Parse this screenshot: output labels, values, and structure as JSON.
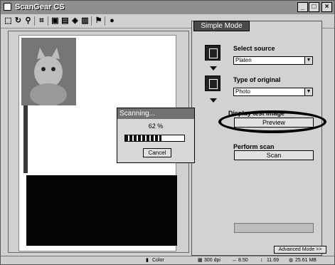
{
  "window": {
    "title": "ScanGear CS",
    "minimize_glyph": "_",
    "maximize_glyph": "□",
    "close_glyph": "×"
  },
  "toolbar": {
    "icons": [
      "select-all-icon",
      "rotate-icon",
      "zoom-icon",
      "fit-icon",
      "film-icon",
      "photo-icon",
      "color-icon",
      "print-icon",
      "flag-icon",
      "info-icon"
    ]
  },
  "panel": {
    "tab_label": "Simple Mode",
    "select_source": {
      "label": "Select source",
      "value": "Platen"
    },
    "type_of_original": {
      "label": "Type of original",
      "value": "Photo"
    },
    "display_test_image": {
      "label": "Display test image",
      "button": "Preview"
    },
    "perform_scan": {
      "label": "Perform scan",
      "button": "Scan"
    },
    "advanced_mode": "Advanced Mode >>"
  },
  "dialog": {
    "title": "Scanning...",
    "percent_text": "62 %",
    "progress": 0.62,
    "cancel_label": "Cancel"
  },
  "status": {
    "color_mode": "Color",
    "resolution": "300 dpi",
    "width": "8.50",
    "height": "11.69",
    "size": "25.61 MB"
  },
  "colors": {
    "window_bg": "#c8c8c8",
    "highlight_ring": "#000000"
  }
}
